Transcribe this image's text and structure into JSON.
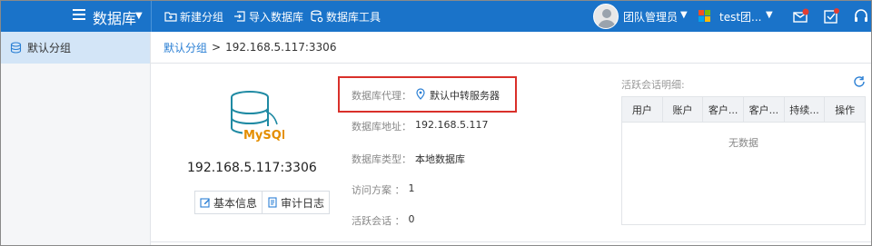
{
  "topbar": {
    "title": "数据库",
    "buttons": [
      {
        "label": "新建分组",
        "icon": "folder-plus-icon"
      },
      {
        "label": "导入数据库",
        "icon": "import-icon"
      },
      {
        "label": "数据库工具",
        "icon": "database-tool-icon"
      }
    ],
    "user_role": "团队管理员",
    "org_name": "test团...",
    "icons": [
      "mail-alert-icon",
      "task-check-icon",
      "headset-icon"
    ],
    "colors": {
      "bar": "#1a73c9",
      "alert": "#e23d32"
    }
  },
  "sidebar": {
    "items": [
      {
        "label": "默认分组",
        "icon": "database-icon",
        "active": true
      }
    ]
  },
  "breadcrumb": {
    "link": "默认分组",
    "separator": ">",
    "current": "192.168.5.117:3306"
  },
  "database": {
    "logo_text": "MySQL",
    "host": "192.168.5.117:3306",
    "actions": [
      {
        "label": "基本信息",
        "icon": "edit-icon"
      },
      {
        "label": "审计日志",
        "icon": "document-icon"
      }
    ],
    "info": [
      {
        "label": "数据库代理：",
        "value": "默认中转服务器",
        "icon": "location-pin-icon"
      },
      {
        "label": "数据库地址：",
        "value": "192.168.5.117"
      },
      {
        "label": "数据库类型：",
        "value": "本地数据库"
      },
      {
        "label": "访问方案  ：",
        "value": "1"
      },
      {
        "label": "活跃会话  ：",
        "value": "0"
      }
    ]
  },
  "sessions": {
    "title": "活跃会话明细:",
    "columns": [
      "用户",
      "账户",
      "客户...",
      "客户...",
      "持续...",
      "操作"
    ],
    "empty_text": "无数据"
  }
}
